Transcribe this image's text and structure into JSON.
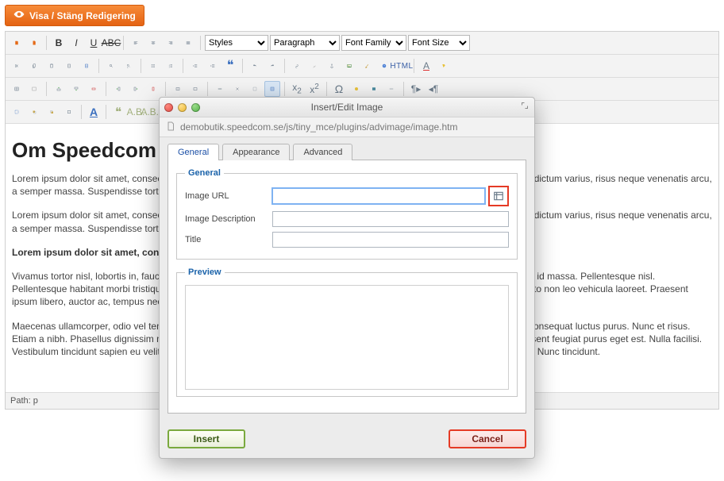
{
  "editbar": {
    "label": "Visa / Stäng Redigering"
  },
  "toolbar": {
    "selects": {
      "styles": "Styles",
      "format": "Paragraph",
      "family": "Font Family",
      "size": "Font Size"
    },
    "html_label": "HTML"
  },
  "content": {
    "heading": "Om Speedcom Datacenter",
    "p1": "Lorem ipsum dolor sit amet, consectetuer adipiscing elit. Proin sed odio et ante adipiscing lobortis. Quisque eleifend, arcu a dictum varius, risus neque venenatis arcu, a semper massa. Suspendisse tortor turpis, porta nec, tempus vitae, iaculis semper neque.",
    "p2": "Lorem ipsum dolor sit amet, consectetuer adipiscing elit. Proin sed odio et ante adipiscing lobortis. Quisque eleifend, arcu a dictum varius, risus neque venenatis arcu, a semper massa. Suspendisse tortor turpis, porta nec, tempus vitae, iaculis semper neque.",
    "p3": "Lorem ipsum dolor sit amet, consectetuer adipiscing elit.",
    "p4": "Vivamus tortor nisl, lobortis in, faucibus et, tempus at, dui. Nunc risus. Proin scelerisque augue. Nam ullamcorper. Phasellus id massa. Pellentesque nisl. Pellentesque habitant morbi tristique senectus et netus et malesuada fames ac turpis egestas. Nunc augue. Aenean sed justo non leo vehicula laoreet. Praesent ipsum libero, auctor ac, tempus nec, tempor nec, justo.",
    "p5": "Maecenas ullamcorper, odio vel tempus egestas, dui orci faucibus orci, sit amet aliquet lectus dolor et quam. Pellentesque consequat luctus purus. Nunc et risus. Etiam a nibh. Phasellus dignissim metus eget nisi. Vestibulum sapien dolor, aliquet nec, porta ac, malesuada a, libero. Praesent feugiat purus eget est. Nulla facilisi. Vestibulum tincidunt sapien eu velit. Mauris purus. Maecenas eget mauris eu orci accumsan feugiat. Pellentesque eget velit. Nunc tincidunt."
  },
  "pathbar": "Path: p",
  "modal": {
    "title": "Insert/Edit Image",
    "url": "demobutik.speedcom.se/js/tiny_mce/plugins/advimage/image.htm",
    "tabs": {
      "general": "General",
      "appearance": "Appearance",
      "advanced": "Advanced"
    },
    "fieldset_general": "General",
    "fieldset_preview": "Preview",
    "labels": {
      "image_url": "Image URL",
      "image_desc": "Image Description",
      "title": "Title"
    },
    "values": {
      "image_url": "",
      "image_desc": "",
      "title": ""
    },
    "buttons": {
      "insert": "Insert",
      "cancel": "Cancel"
    }
  }
}
